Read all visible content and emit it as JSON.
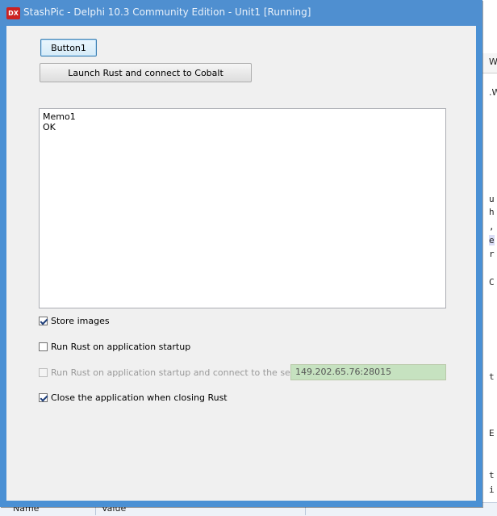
{
  "window": {
    "title": "StashPic - Delphi 10.3 Community Edition - Unit1 [Running]",
    "icon_text": "DX"
  },
  "buttons": {
    "button1_label": "Button1",
    "launch_label": "Launch Rust and connect to Cobalt"
  },
  "memo": {
    "lines": [
      "Memo1",
      "OK"
    ]
  },
  "options": {
    "store_images": {
      "label": "Store images",
      "checked": true,
      "enabled": true
    },
    "run_on_startup": {
      "label": "Run Rust on application startup",
      "checked": false,
      "enabled": true
    },
    "run_and_connect": {
      "label": "Run Rust on application startup and connect to the server :",
      "checked": false,
      "enabled": false
    },
    "close_app": {
      "label": "Close the application when closing Rust",
      "checked": true,
      "enabled": true
    }
  },
  "server": {
    "value": "149.202.65.76:28015"
  },
  "background_ide": {
    "tab_fragment": "W",
    "tab_fragment2": ".W",
    "code_fragments": [
      "u",
      "h",
      ",",
      "e",
      "r",
      "C",
      "t",
      "E",
      "t",
      "i"
    ],
    "bottom_columns": [
      "Name",
      "Value"
    ]
  },
  "colors": {
    "titlebar": "#4f8fd0",
    "server_field_bg": "#c6e2c0"
  }
}
